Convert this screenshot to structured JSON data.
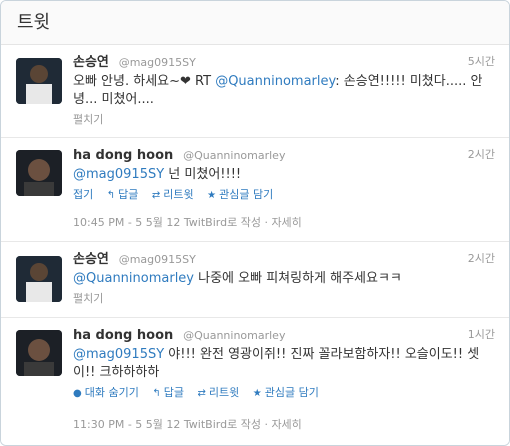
{
  "header": {
    "title": "트윗"
  },
  "tweets": [
    {
      "name": "손승연",
      "handle": "@mag0915SY",
      "time": "5시간",
      "text_pre": "오빠 안녕. 하세요~❤ RT ",
      "mention": "@Quanninomarley",
      "text_post": ": 손승연!!!!! 미쳤다..... 안녕... 미쳤어....",
      "expand_label": "펼치기"
    },
    {
      "name": "ha dong hoon",
      "handle": "@Quanninomarley",
      "time": "2시간",
      "mention": "@mag0915SY",
      "text_post": " 넌 미쳤어!!!!",
      "actions": {
        "collapse": "접기",
        "reply": "답글",
        "retweet": "리트윗",
        "favorite": "관심글 담기"
      },
      "meta": {
        "datetime": "10:45 PM - 5 5월 12",
        "via": "TwitBird",
        "via_suffix": "로 작성",
        "sep": "·",
        "details": "자세히"
      }
    },
    {
      "name": "손승연",
      "handle": "@mag0915SY",
      "time": "2시간",
      "mention": "@Quanninomarley",
      "text_post": " 나중에 오빠 피쳐링하게 해주세요ㅋㅋ",
      "expand_label": "펼치기"
    },
    {
      "name": "ha dong hoon",
      "handle": "@Quanninomarley",
      "time": "1시간",
      "mention": "@mag0915SY",
      "text_post": " 야!!! 완전 영광이쥐!! 진짜 꼴라보함하자!! 오슬이도!! 셋이!! 크하하하하",
      "actions": {
        "conversation": "대화 숨기기",
        "reply": "답글",
        "retweet": "리트윗",
        "favorite": "관심글 담기"
      },
      "meta": {
        "datetime": "11:30 PM - 5 5월 12",
        "via": "TwitBird",
        "via_suffix": "로 작성",
        "sep": "·",
        "details": "자세히"
      }
    }
  ],
  "colors": {
    "link": "#2f7bbf",
    "muted": "#999999",
    "text": "#333333"
  },
  "icons": {
    "reply": "reply-arrow-icon",
    "retweet": "retweet-icon",
    "favorite": "star-icon",
    "conversation": "speech-bubble-icon"
  }
}
